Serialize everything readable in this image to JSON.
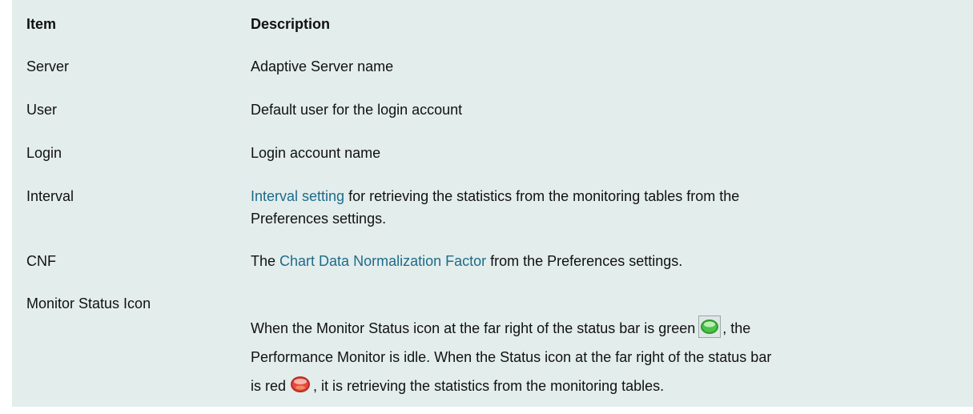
{
  "header": {
    "item": "Item",
    "description": "Description"
  },
  "rows": [
    {
      "item": "Server",
      "description": "Adaptive Server name"
    },
    {
      "item": "User",
      "description": "Default user for the login account"
    },
    {
      "item": "Login",
      "description": "Login account name"
    },
    {
      "item": "Interval",
      "link_text": "Interval setting",
      "description_line1": " for retrieving the statistics from the monitoring tables from the",
      "description_line2": "Preferences settings."
    },
    {
      "item": "CNF",
      "prefix": "The ",
      "link_text": "Chart Data Normalization Factor",
      "suffix": " from the Preferences settings."
    },
    {
      "item": "Monitor Status Icon",
      "line1_before_icon": "When the Monitor Status icon at the far right of the status bar is green",
      "line1_after_icon": ", the",
      "line2": "Performance Monitor is idle. When the Status icon at the far right of the status bar",
      "line3_before_icon": "is red",
      "line3_after_icon": ", it is retrieving the statistics from the monitoring tables."
    }
  ],
  "icons": {
    "green": {
      "name": "green-status-icon",
      "color": "#4cc24a"
    },
    "red": {
      "name": "red-status-icon",
      "color": "#e8473e"
    }
  },
  "colors": {
    "panel_background": "#e3edec",
    "link": "#1e6b8a"
  }
}
